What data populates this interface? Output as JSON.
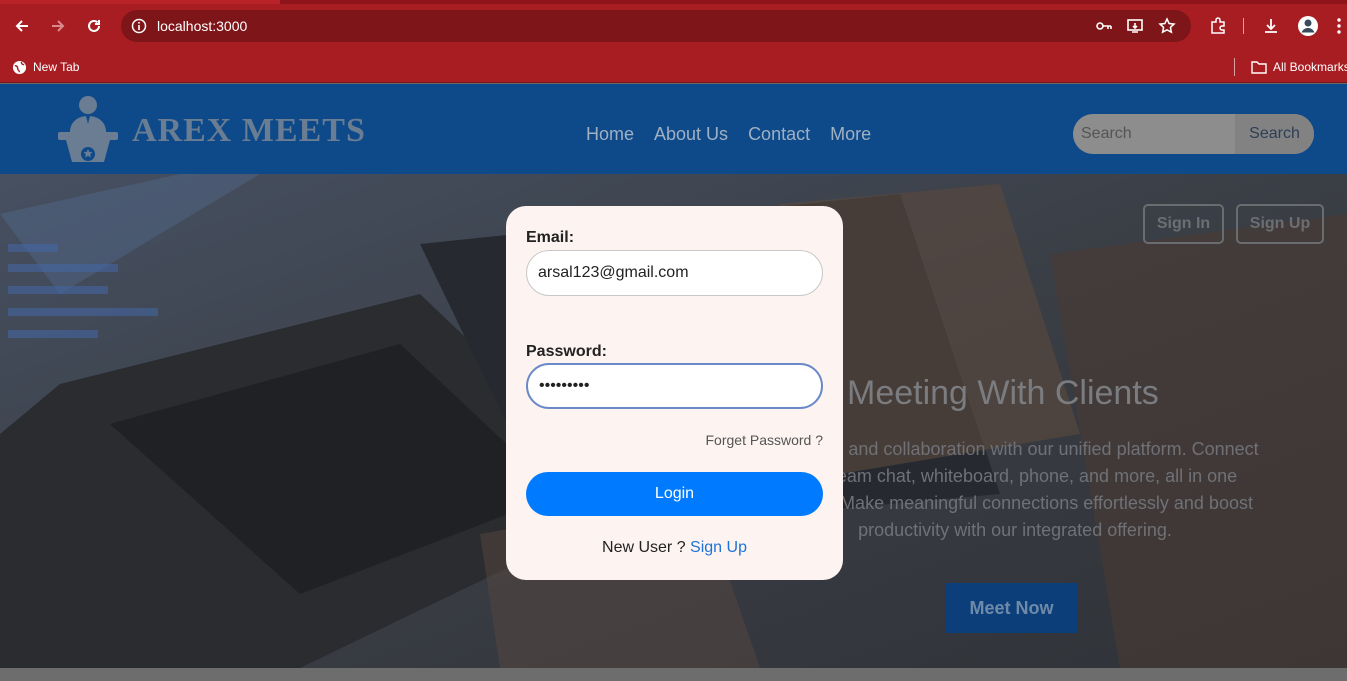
{
  "browser": {
    "url": "localhost:3000",
    "bookmarks": {
      "new_tab": "New Tab",
      "all_bookmarks": "All Bookmarks"
    }
  },
  "site": {
    "brand": "AREX MEETS",
    "nav": [
      "Home",
      "About Us",
      "Contact",
      "More"
    ],
    "search": {
      "placeholder": "Search",
      "button": "Search"
    }
  },
  "hero": {
    "title": "Meeting With Clients",
    "description_lines": [
      "unication and collaboration with our unified platform. Connect",
      "ngs, team chat, whiteboard, phone, and more, all in one",
      "olution. Make meaningful connections effortlessly and boost",
      "productivity with our integrated offering."
    ],
    "meet_button": "Meet Now",
    "sign_in": "Sign In",
    "sign_up": "Sign Up"
  },
  "login_modal": {
    "email_label": "Email:",
    "email_value": "arsal123@gmail.com",
    "password_label": "Password:",
    "password_value": "•••••••••",
    "forgot": "Forget Password ?",
    "login_button": "Login",
    "new_user": "New User ?",
    "signup_link": "Sign Up"
  },
  "colors": {
    "chrome": "#a81d22",
    "header": "#0e4a8a",
    "login_button": "#007bff",
    "modal_bg": "#fdf3f1"
  }
}
